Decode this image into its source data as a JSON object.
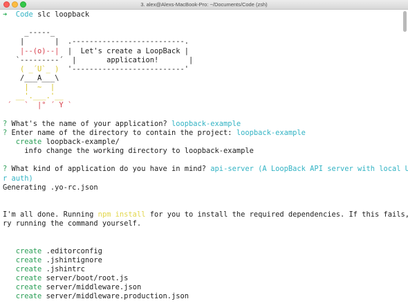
{
  "window": {
    "title": "3. alex@Alexs-MacBook-Pro: ~/Documents/Code (zsh)"
  },
  "prompt": {
    "arrow": "➜",
    "dir": "Code",
    "command": "slc loopback"
  },
  "banner": {
    "yeoman": [
      "     _-----_",
      "    |       |",
      "    |--(o)--|",
      "   `---------´",
      "    ( _´U`_ )",
      "    /___A___\\",
      "     |  ~  |",
      "   __'.___.'__",
      " ´   `  |° ´ Y `"
    ],
    "speech": [
      "  .--------------------------.",
      "  |  Let's create a LoopBack |",
      "  |       application!       |",
      "  '--------------------------'"
    ]
  },
  "session": {
    "q1_mark": "?",
    "q1_text": " What's the name of your application? ",
    "q1_answer": "loopback-example",
    "q2_mark": "?",
    "q2_text": " Enter name of the directory to contain the project: ",
    "q2_answer": "loopback-example",
    "create_label": "create",
    "create_dir": " loopback-example/",
    "info_label": "info",
    "info_text": " change the working directory to loopback-example",
    "q3_mark": "?",
    "q3_text": " What kind of application do you have in mind? ",
    "q3_answer_1": "api-server (A LoopBack API server with local Use",
    "q3_answer_2": "r auth)",
    "generating": "Generating .yo-rc.json",
    "done_1a": "I'm all done. Running ",
    "done_1b": "npm install",
    "done_1c": " for you to install the required dependencies. If this fails, t",
    "done_2": "ry running the command yourself."
  },
  "files": [
    {
      "action": "create",
      "path": " .editorconfig"
    },
    {
      "action": "create",
      "path": " .jshintignore"
    },
    {
      "action": "create",
      "path": " .jshintrc"
    },
    {
      "action": "create",
      "path": " server/boot/root.js"
    },
    {
      "action": "create",
      "path": " server/middleware.json"
    },
    {
      "action": "create",
      "path": " server/middleware.production.json"
    }
  ],
  "colors": {
    "cyan": "#32b3c4",
    "green": "#2a9e56",
    "yellow": "#d6c324",
    "red": "#d73d4a"
  }
}
